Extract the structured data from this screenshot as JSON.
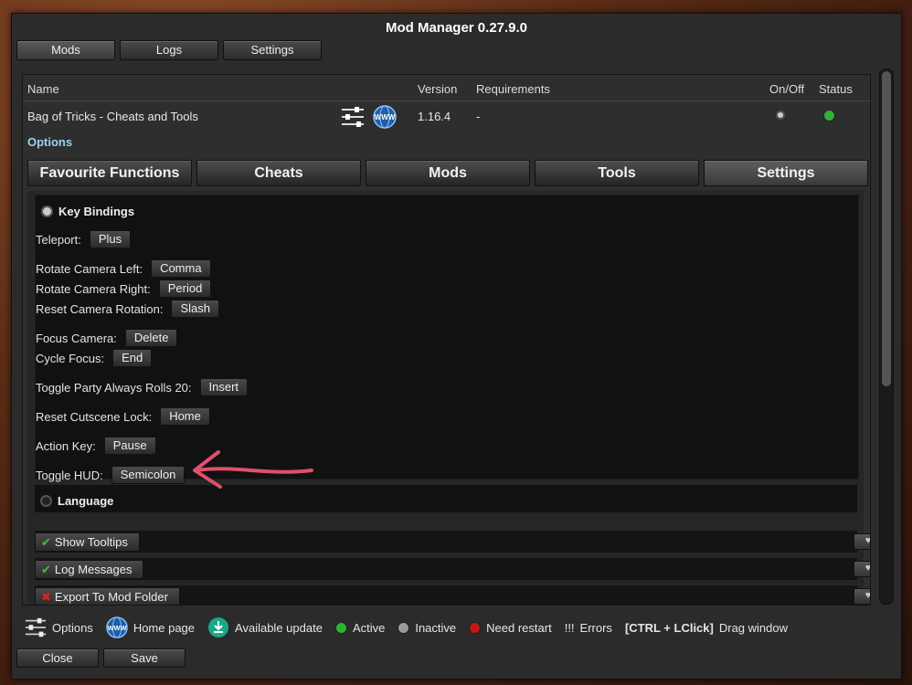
{
  "window": {
    "title": "Mod Manager 0.27.9.0"
  },
  "topnav": [
    {
      "label": "Mods"
    },
    {
      "label": "Logs"
    },
    {
      "label": "Settings"
    }
  ],
  "columns": {
    "name": "Name",
    "version": "Version",
    "requirements": "Requirements",
    "onoff": "On/Off",
    "status": "Status"
  },
  "mod": {
    "name": "Bag of Tricks - Cheats and Tools",
    "version": "1.16.4",
    "requirements": "-",
    "options_link": "Options",
    "status_color": "#2fb32f",
    "www_icon_text": "WWW"
  },
  "tabs": [
    {
      "label": "Favourite Functions"
    },
    {
      "label": "Cheats"
    },
    {
      "label": "Mods"
    },
    {
      "label": "Tools"
    },
    {
      "label": "Settings"
    }
  ],
  "keybindings": {
    "title": "Key Bindings",
    "items": [
      {
        "label": "Teleport:",
        "key": "Plus"
      },
      {
        "label": "Rotate Camera Left:",
        "key": "Comma"
      },
      {
        "label": "Rotate Camera Right:",
        "key": "Period"
      },
      {
        "label": "Reset Camera Rotation:",
        "key": "Slash"
      },
      {
        "label": "Focus Camera:",
        "key": "Delete"
      },
      {
        "label": "Cycle Focus:",
        "key": "End"
      },
      {
        "label": "Toggle Party Always Rolls 20:",
        "key": "Insert"
      },
      {
        "label": "Reset Cutscene Lock:",
        "key": "Home"
      },
      {
        "label": "Action Key:",
        "key": "Pause"
      },
      {
        "label": "Toggle HUD:",
        "key": "Semicolon"
      }
    ]
  },
  "language": {
    "title": "Language"
  },
  "toggles": [
    {
      "label": "Show Tooltips",
      "state": "on"
    },
    {
      "label": "Log Messages",
      "state": "on"
    },
    {
      "label": "Export To Mod Folder",
      "state": "off"
    }
  ],
  "legend": {
    "options": "Options",
    "homepage": "Home page",
    "homepage_icon_text": "WWW",
    "available_update": "Available update",
    "active": "Active",
    "inactive": "Inactive",
    "need_restart": "Need restart",
    "errors_mark": "!!!",
    "errors": "Errors",
    "shortcut": "[CTRL + LClick]",
    "drag": "Drag window",
    "colors": {
      "active": "#2fb32f",
      "inactive": "#9a9a9a",
      "need_restart": "#c01818"
    }
  },
  "bottom": {
    "close": "Close",
    "save": "Save"
  },
  "annotation_color": "#e0506a"
}
